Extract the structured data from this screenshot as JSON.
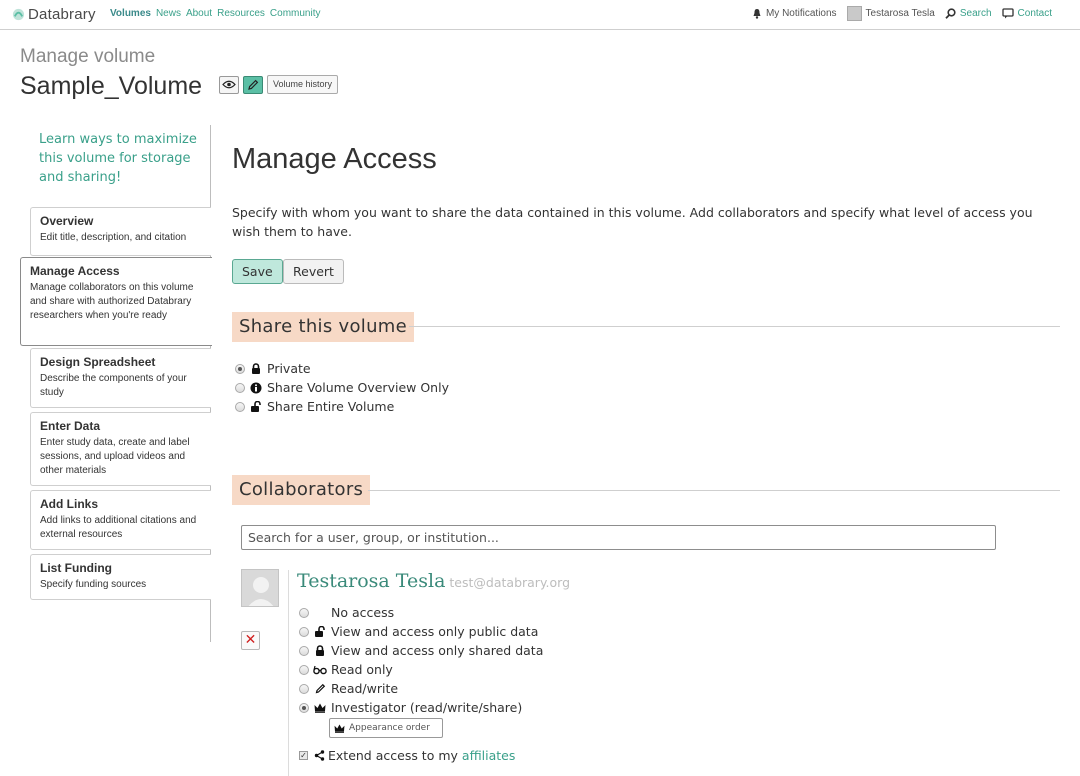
{
  "nav": {
    "brand": "Databrary",
    "links": [
      "Volumes",
      "News",
      "About",
      "Resources",
      "Community"
    ],
    "notifications": "My Notifications",
    "user": "Testarosa Tesla",
    "search": "Search",
    "contact": "Contact"
  },
  "header": {
    "subtitle": "Manage volume",
    "title": "Sample_Volume",
    "history_button": "Volume history"
  },
  "sidebar": {
    "intro": "Learn ways to maximize this volume for storage and sharing!",
    "items": [
      {
        "label": "Overview",
        "desc": "Edit title, description, and citation"
      },
      {
        "label": "Manage Access",
        "desc": "Manage collaborators on this volume and share with authorized Databrary researchers when you're ready"
      },
      {
        "label": "Design Spreadsheet",
        "desc": "Describe the components of your study"
      },
      {
        "label": "Enter Data",
        "desc": "Enter study data, create and label sessions, and upload videos and other materials"
      },
      {
        "label": "Add Links",
        "desc": "Add links to additional citations and external resources"
      },
      {
        "label": "List Funding",
        "desc": "Specify funding sources"
      }
    ]
  },
  "main": {
    "title": "Manage Access",
    "description": "Specify with whom you want to share the data contained in this volume. Add collaborators and specify what level of access you wish them to have.",
    "save_label": "Save",
    "revert_label": "Revert",
    "share_heading": "Share this volume",
    "share_options": [
      "Private",
      "Share Volume Overview Only",
      "Share Entire Volume"
    ],
    "share_selected": "Private",
    "collab_heading": "Collaborators",
    "search_placeholder": "Search for a user, group, or institution...",
    "collaborator": {
      "name": "Testarosa Tesla",
      "email": "test@databrary.org",
      "access_options": [
        "No access",
        "View and access only public data",
        "View and access only shared data",
        "Read only",
        "Read/write",
        "Investigator (read/write/share)"
      ],
      "access_selected": "Investigator (read/write/share)",
      "order_placeholder": "Appearance order",
      "extend_text": "Extend access to my",
      "extend_link": "affiliates",
      "extend_checked": true
    }
  },
  "colors": {
    "teal": "#3aa08a",
    "section_bg": "#f7d9c6",
    "save_bg": "#bfe8dc"
  }
}
